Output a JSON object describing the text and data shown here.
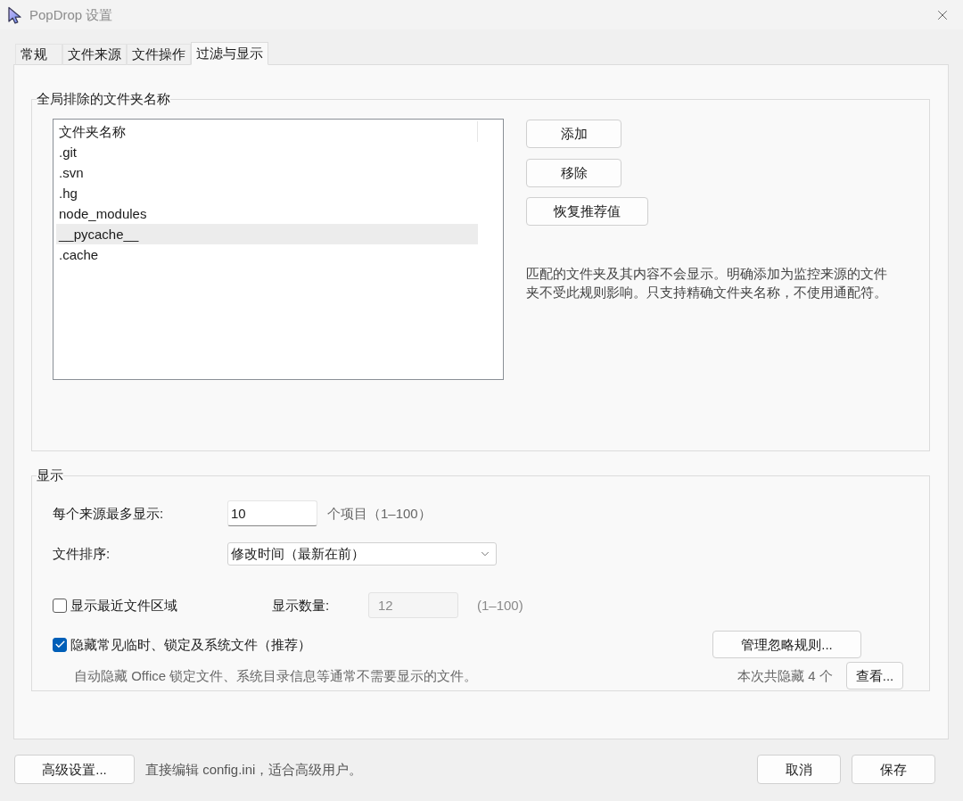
{
  "window": {
    "title": "PopDrop 设置"
  },
  "tabs": [
    {
      "label": "常规",
      "selected": false
    },
    {
      "label": "文件来源",
      "selected": false
    },
    {
      "label": "文件操作",
      "selected": false
    },
    {
      "label": "过滤与显示",
      "selected": true
    }
  ],
  "excluded_folders": {
    "title": "全局排除的文件夹名称",
    "column": "文件夹名称",
    "rows": [
      {
        "name": ".git",
        "selected": false
      },
      {
        "name": ".svn",
        "selected": false
      },
      {
        "name": ".hg",
        "selected": false
      },
      {
        "name": "node_modules",
        "selected": false
      },
      {
        "name": "__pycache__",
        "selected": true
      },
      {
        "name": ".cache",
        "selected": false
      }
    ],
    "buttons": [
      "添加",
      "移除",
      "恢复推荐值"
    ],
    "note": "匹配的文件夹及其内容不会显示。明确添加为监控来源的文件夹不受此规则影响。只支持精确文件夹名称，不使用通配符。"
  },
  "display": {
    "title": "显示",
    "max_per_source": {
      "label": "每个来源最多显示:",
      "value": "10",
      "hint": "个项目（1–100）"
    },
    "sort": {
      "label": "文件排序:",
      "value": "修改时间（最新在前）"
    },
    "recent_area": {
      "label": "显示最近文件区域",
      "checked": false,
      "count_field": {
        "label": "显示数量:",
        "value": "12",
        "disabled": true,
        "hint": "(1–100)"
      }
    },
    "hide_system": {
      "label": "隐藏常见临时、锁定及系统文件（推荐）",
      "checked": true,
      "description": "自动隐藏 Office 锁定文件、系统目录信息等通常不需要显示的文件。",
      "manage_button": "管理忽略规则...",
      "hidden_count": "本次共隐藏 4 个",
      "view_button": "查看..."
    }
  },
  "footer": {
    "advanced_button": "高级设置...",
    "advanced_note": "直接编辑 config.ini，适合高级用户。",
    "buttons": [
      "取消",
      "保存"
    ]
  }
}
